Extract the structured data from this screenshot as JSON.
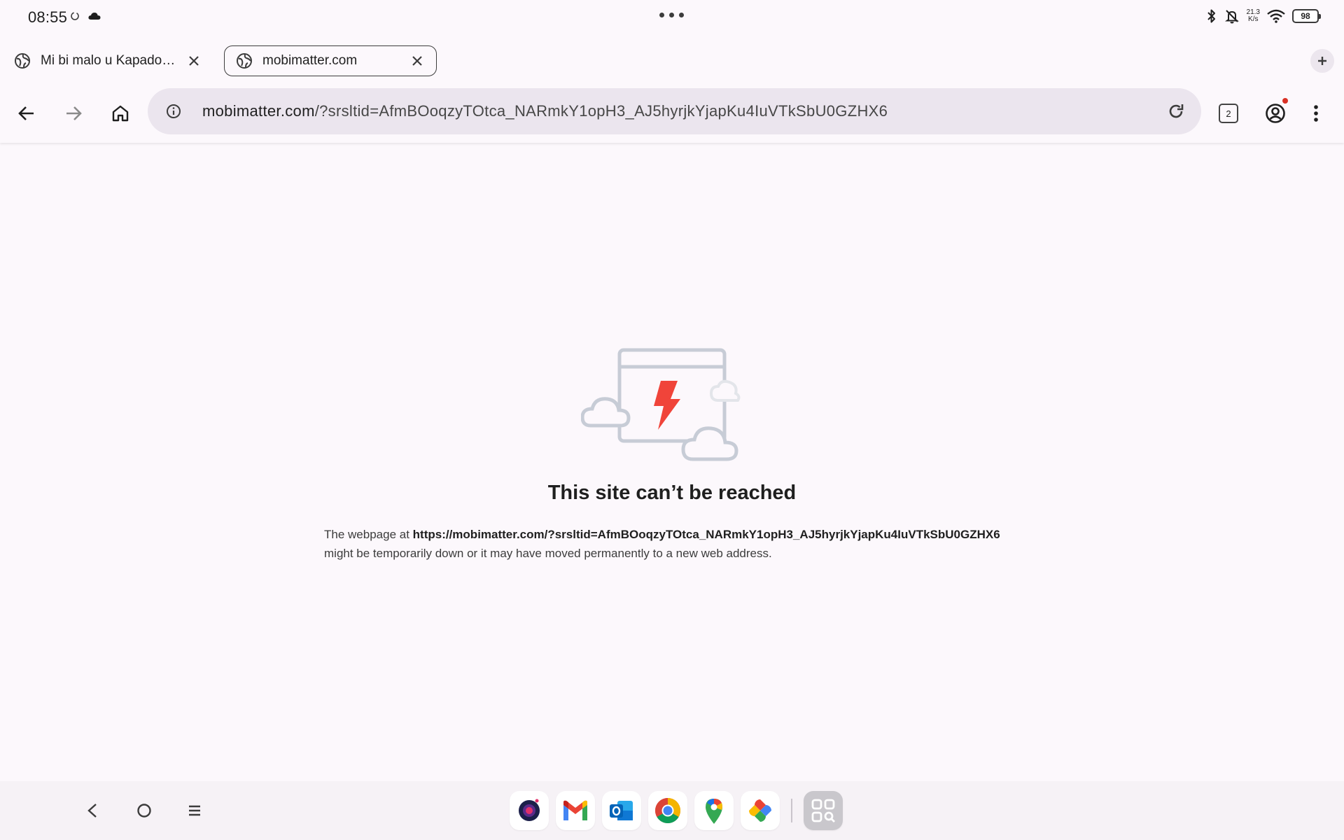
{
  "status_bar": {
    "time": "08:55",
    "net_speed_value": "21.3",
    "net_speed_unit": "K/s",
    "battery_level": "98",
    "icons": [
      "sync-icon",
      "cloud-icon",
      "bluetooth-icon",
      "mute-icon",
      "wifi-icon",
      "battery-icon"
    ]
  },
  "tabs": [
    {
      "title": "Mi bi malo u Kapado…",
      "active": false
    },
    {
      "title": "mobimatter.com",
      "active": true
    }
  ],
  "toolbar": {
    "url_host": "mobimatter.com",
    "url_path": "/?srsltid=AfmBOoqzyTOtca_NARmkY1opH3_AJ5hyrjkYjapKu4IuVTkSbU0GZHX6",
    "tab_count": "2"
  },
  "error_page": {
    "title": "This site can’t be reached",
    "desc_prefix": "The webpage at ",
    "desc_url": "https://mobimatter.com/?srsltid=AfmBOoqzyTOtca_NARmkY1opH3_AJ5hyrjkYjapKu4IuVTkSbU0GZHX6",
    "desc_suffix": "might be temporarily down or it may have moved permanently to a new web address."
  },
  "dock": {
    "apps": [
      "Camera",
      "Gmail",
      "Outlook",
      "Chrome",
      "Maps",
      "Photos",
      "App drawer"
    ]
  },
  "colors": {
    "background": "#fcf8fc",
    "omnibox": "#ebe5ee",
    "error_bolt": "#f0443a",
    "illustration_stroke": "#c7ccd6"
  }
}
